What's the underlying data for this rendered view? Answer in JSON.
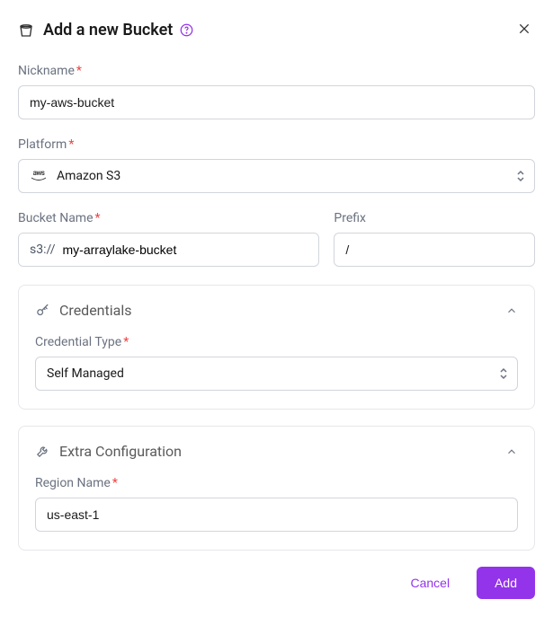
{
  "header": {
    "title": "Add a new Bucket"
  },
  "nickname": {
    "label": "Nickname",
    "value": "my-aws-bucket"
  },
  "platform": {
    "label": "Platform",
    "selected": "Amazon S3"
  },
  "bucket_name": {
    "label": "Bucket Name",
    "scheme": "s3://",
    "value": "my-arraylake-bucket"
  },
  "prefix": {
    "label": "Prefix",
    "value": "/"
  },
  "credentials": {
    "title": "Credentials",
    "type_label": "Credential Type",
    "type_value": "Self Managed"
  },
  "extra_config": {
    "title": "Extra Configuration",
    "region_label": "Region Name",
    "region_value": "us-east-1"
  },
  "footer": {
    "cancel": "Cancel",
    "add": "Add"
  }
}
